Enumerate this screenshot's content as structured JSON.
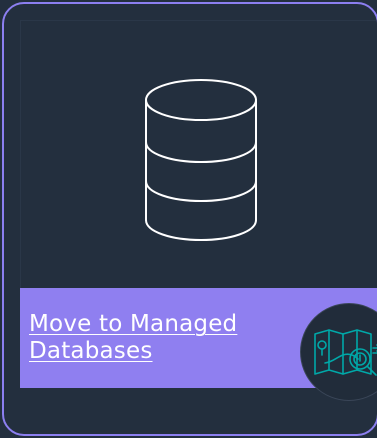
{
  "card": {
    "title": "Move to Managed Databases",
    "accent_color": "#8f7ff0",
    "background_color": "#232f3e"
  },
  "hero": {
    "icon": "database-icon"
  },
  "badge": {
    "icon": "migration-map-icon",
    "accent_color": "#00a8a8"
  }
}
